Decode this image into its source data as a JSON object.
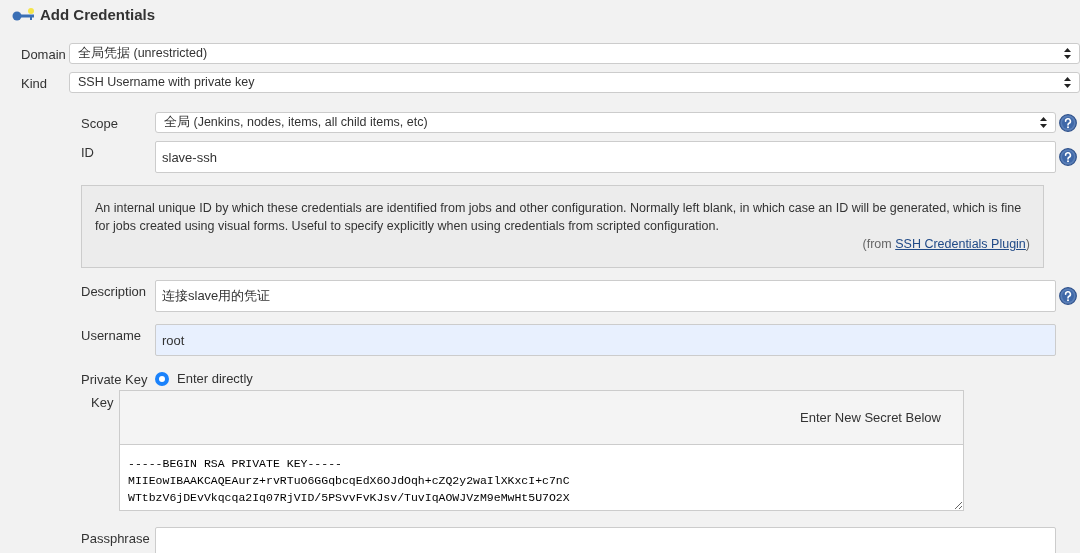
{
  "title": "Add Credentials",
  "top_fields": [
    {
      "label": "Domain",
      "value": "全局凭据 (unrestricted)"
    },
    {
      "label": "Kind",
      "value": "SSH Username with private key"
    }
  ],
  "rows": [
    {
      "kind": "select",
      "label": "Scope",
      "value": "全局 (Jenkins, nodes, items, all child items, etc)",
      "help": true
    },
    {
      "kind": "text",
      "label": "ID",
      "value": "slave-ssh",
      "help": true,
      "autofilled": false
    },
    {
      "kind": "helpbox",
      "text": "An internal unique ID by which these credentials are identified from jobs and other configuration. Normally left blank, in which case an ID will be generated, which is fine for jobs created using visual forms. Useful to specify explicitly when using credentials from scripted configuration.",
      "source_before": "(from ",
      "link": "SSH Credentials Plugin",
      "source_after": ")"
    },
    {
      "kind": "text",
      "label": "Description",
      "value": "连接slave用的凭证",
      "help": true,
      "autofilled": false
    },
    {
      "kind": "text",
      "label": "Username",
      "value": "root",
      "help": false,
      "autofilled": true
    },
    {
      "kind": "privatekey",
      "label": "Private Key",
      "option": {
        "label": "Enter directly",
        "selected": true
      },
      "key_label": "Key",
      "secret_note": "Enter New Secret Below",
      "key_lines": [
        "-----BEGIN RSA PRIVATE KEY-----",
        "MIIEowIBAAKCAQEAurz+rvRTuO6GGqbcqEdX6OJdOqh+cZQ2y2waIlXKxcI+c7nC",
        "WTtbzV6jDEvVkqcqa2Iq07RjVID/5PSvvFvKJsv/TuvIqAOWJVzM9eMwHt5U7O2X"
      ]
    },
    {
      "kind": "text",
      "label": "Passphrase",
      "value": "",
      "help": false,
      "autofilled": false
    }
  ]
}
